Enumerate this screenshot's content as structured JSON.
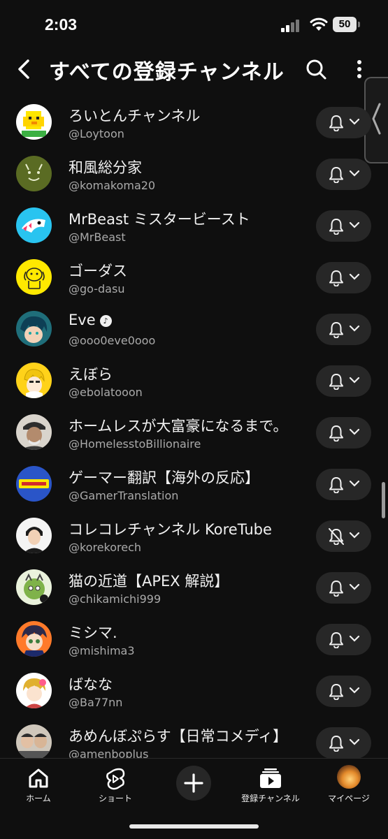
{
  "status_bar": {
    "time": "2:03",
    "battery": "50"
  },
  "header": {
    "title": "すべての登録チャンネル"
  },
  "channels": [
    {
      "name": "ろいとんチャンネル",
      "handle": "@Loytoon",
      "verified": false,
      "notifications": "on"
    },
    {
      "name": "和風総分家",
      "handle": "@komakoma20",
      "verified": false,
      "notifications": "on"
    },
    {
      "name": "MrBeast ミスタービースト",
      "handle": "@MrBeast",
      "verified": false,
      "notifications": "on"
    },
    {
      "name": "ゴーダス",
      "handle": "@go-dasu",
      "verified": false,
      "notifications": "on"
    },
    {
      "name": "Eve",
      "handle": "@ooo0eve0ooo",
      "verified": true,
      "notifications": "on"
    },
    {
      "name": "えぼら",
      "handle": "@ebolatooon",
      "verified": false,
      "notifications": "on"
    },
    {
      "name": "ホームレスが大富豪になるまで。",
      "handle": "@HomelesstoBillionaire",
      "verified": false,
      "notifications": "on"
    },
    {
      "name": "ゲーマー翻訳【海外の反応】",
      "handle": "@GamerTranslation",
      "verified": false,
      "notifications": "on"
    },
    {
      "name": "コレコレチャンネル KoreTube",
      "handle": "@korekorech",
      "verified": false,
      "notifications": "off"
    },
    {
      "name": "猫の近道【APEX 解説】",
      "handle": "@chikamichi999",
      "verified": false,
      "notifications": "on"
    },
    {
      "name": "ミシマ.",
      "handle": "@mishima3",
      "verified": false,
      "notifications": "on"
    },
    {
      "name": "ばなな",
      "handle": "@Ba77nn",
      "verified": false,
      "notifications": "on"
    },
    {
      "name": "あめんぼぷらす【日常コメディ】",
      "handle": "@amenboplus",
      "verified": false,
      "notifications": "on"
    }
  ],
  "bottom_nav": {
    "home": "ホーム",
    "shorts": "ショート",
    "subscriptions": "登録チャンネル",
    "you": "マイページ"
  },
  "colors": {
    "background": "#0f0f0f",
    "button_bg": "#272727",
    "text_primary": "#f1f1f1",
    "text_secondary": "#aaaaaa"
  }
}
